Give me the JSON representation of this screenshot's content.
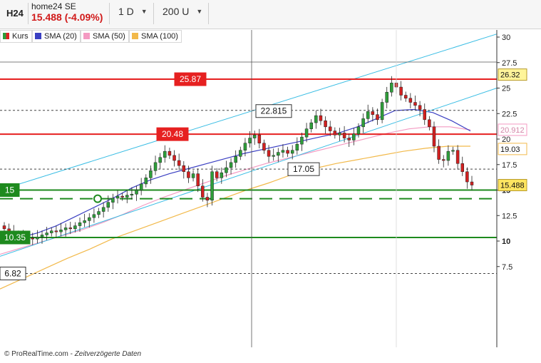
{
  "header": {
    "ticker": "H24",
    "name": "home24 SE",
    "price_change": "15.488 (-4.09%)",
    "price_color": "#d11a1a",
    "interval": "1 D",
    "units": "200 U",
    "dropdown_icon": "chevron-down-icon"
  },
  "legend": [
    {
      "label": "Kurs",
      "color": "#2e9e3a"
    },
    {
      "label": "SMA (20)",
      "color": "#3a3fc2"
    },
    {
      "label": "SMA (50)",
      "color": "#f49ac2"
    },
    {
      "label": "SMA (100)",
      "color": "#f2b94a"
    }
  ],
  "footer": {
    "source": "© ProRealTime.com",
    "note": "Zeitverzögerte Daten"
  },
  "chart_data": {
    "type": "candlestick",
    "y_ticks": [
      "30",
      "27.5",
      "25",
      "22.5",
      "20",
      "17.5",
      "15",
      "12.5",
      "10",
      "7.5"
    ],
    "ylim": [
      4.4,
      31.5
    ],
    "x_count": 200,
    "grid": false,
    "candles_approx_close": [
      11.2,
      10.9,
      10.6,
      10.4,
      10.5,
      10.3,
      10.2,
      10.4,
      10.6,
      10.8,
      11.0,
      10.9,
      11.1,
      11.3,
      11.2,
      11.5,
      11.8,
      12.0,
      12.3,
      12.6,
      12.9,
      13.3,
      13.8,
      14.2,
      14.4,
      14.3,
      14.5,
      14.6,
      15.0,
      15.6,
      16.2,
      16.9,
      17.7,
      18.2,
      18.8,
      18.4,
      17.9,
      17.4,
      16.8,
      16.2,
      16.6,
      15.4,
      14.3,
      14.0,
      16.8,
      16.2,
      16.7,
      17.2,
      17.7,
      18.3,
      18.9,
      19.6,
      20.1,
      20.4,
      19.6,
      18.9,
      18.3,
      18.4,
      18.7,
      18.9,
      18.6,
      18.9,
      19.5,
      20.2,
      21.0,
      21.6,
      22.3,
      21.8,
      21.2,
      20.8,
      20.4,
      20.6,
      20.1,
      19.9,
      20.5,
      21.2,
      22.0,
      22.7,
      22.4,
      21.9,
      23.6,
      24.6,
      25.5,
      25.1,
      24.3,
      24.0,
      23.6,
      23.3,
      22.9,
      21.9,
      21.2,
      19.3,
      18.0,
      17.9,
      18.8,
      18.9,
      17.6,
      16.8,
      15.8,
      15.488
    ],
    "sma_20_approx": [
      10.0,
      10.3,
      10.8,
      11.5,
      12.4,
      13.3,
      14.2,
      15.2,
      16.0,
      16.6,
      17.1,
      17.6,
      18.1,
      18.6,
      19.0,
      19.4,
      19.8,
      20.2,
      20.6,
      21.2,
      22.0,
      22.8,
      22.9,
      22.6,
      21.8,
      20.8
    ],
    "sma_50_approx": [
      8.7,
      9.3,
      9.9,
      10.5,
      11.1,
      11.8,
      12.6,
      13.5,
      14.3,
      15.0,
      15.7,
      16.4,
      17.0,
      17.6,
      18.1,
      18.6,
      19.1,
      19.6,
      20.1,
      20.6,
      21.0,
      21.2,
      21.2,
      20.9
    ],
    "sma_100_approx": [
      5.3,
      6.3,
      7.3,
      8.3,
      9.2,
      10.2,
      11.0,
      11.8,
      12.6,
      13.4,
      14.2,
      15.0,
      15.7,
      16.5,
      17.1,
      17.6,
      18.0,
      18.4,
      18.8,
      19.1,
      19.3,
      19.3
    ],
    "levels": [
      {
        "label": "25.87",
        "value": 25.87,
        "style": "solid",
        "color": "#e62020"
      },
      {
        "label": "20.48",
        "value": 20.48,
        "style": "solid",
        "color": "#e62020"
      },
      {
        "label": "22.815",
        "value": 22.815,
        "style": "dashed",
        "color": "#444444"
      },
      {
        "label": "17.05",
        "value": 17.05,
        "style": "dashed",
        "color": "#444444"
      },
      {
        "label": "15",
        "value": 15.0,
        "style": "solid",
        "color": "#1e8a1e"
      },
      {
        "label": "10.35",
        "value": 10.35,
        "style": "solid",
        "color": "#1e8a1e"
      },
      {
        "label": "6.82",
        "value": 6.82,
        "style": "dashed",
        "color": "#444444"
      }
    ],
    "axis_badges": [
      {
        "label": "26.32",
        "value": 26.32,
        "bg": "#fff59a",
        "border": "#b79a2a"
      },
      {
        "label": "20.912",
        "value": 20.912,
        "bg": "#ffffff",
        "border": "#f49ac2",
        "text": "#d486a8"
      },
      {
        "label": "19.03",
        "value": 19.03,
        "bg": "#ffffff",
        "border": "#f2b94a"
      },
      {
        "label": "15.488",
        "value": 15.488,
        "bg": "#ffe560",
        "border": "#b79a2a"
      }
    ],
    "trend_channel_color": "#39bde4",
    "green_dashed_level": 14.15
  }
}
